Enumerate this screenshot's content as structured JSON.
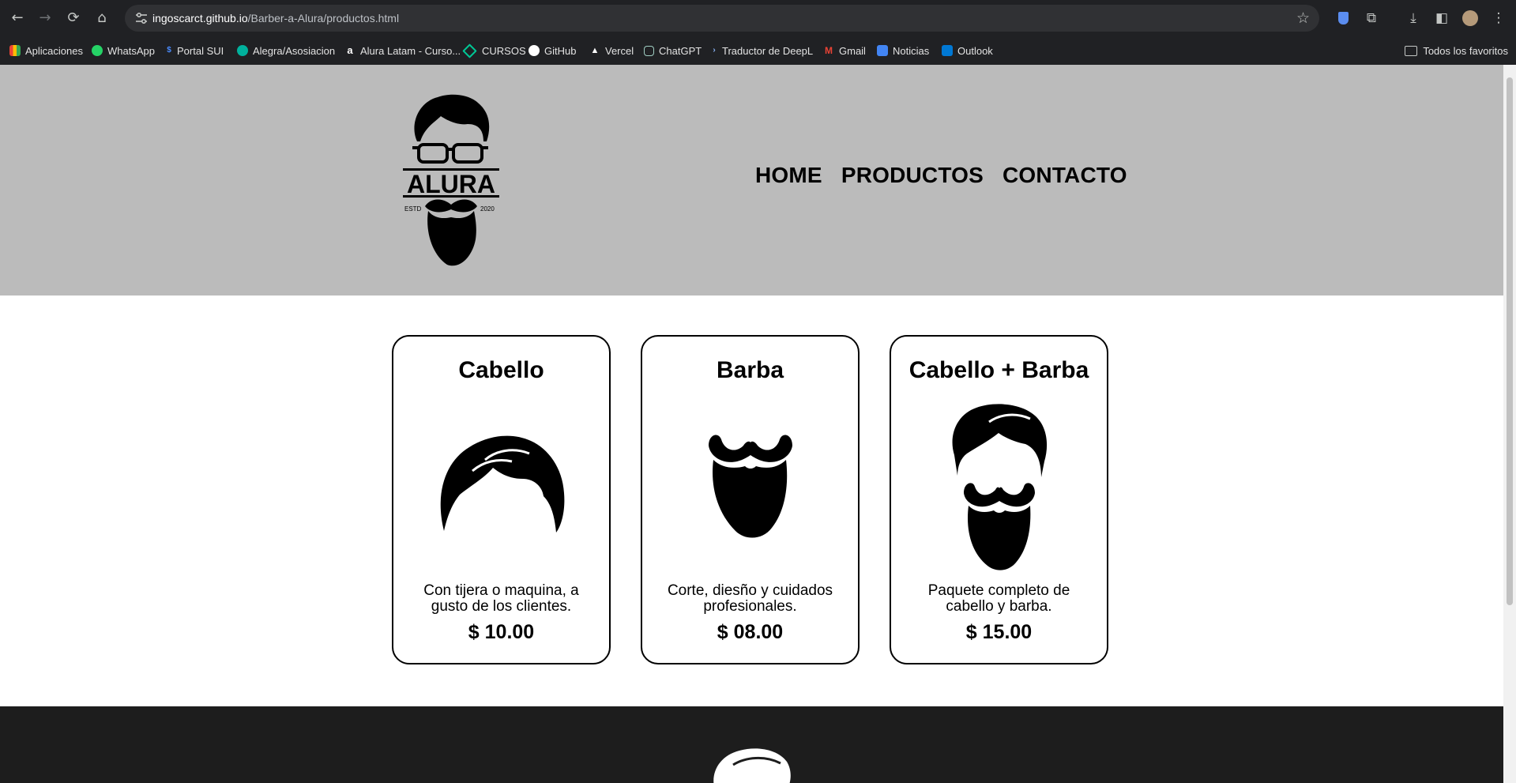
{
  "browser": {
    "url_host": "ingoscarct.github.io",
    "url_path": "/Barber-a-Alura/productos.html",
    "bookmarks": [
      {
        "label": "Aplicaciones",
        "icon": "apps-grid-icon",
        "color": "#ea4335"
      },
      {
        "label": "WhatsApp",
        "icon": "whatsapp-icon",
        "color": "#25d366"
      },
      {
        "label": "Portal SUI",
        "icon": "portal-sui-icon",
        "color": "#1a73e8"
      },
      {
        "label": "Alegra/Asosiacion",
        "icon": "alegra-icon",
        "color": "#00b19d"
      },
      {
        "label": "Alura Latam - Curso...",
        "icon": "alura-icon",
        "color": "#ffffff"
      },
      {
        "label": "CURSOS",
        "icon": "cursos-icon",
        "color": "#00c896"
      },
      {
        "label": "GitHub",
        "icon": "github-icon",
        "color": "#ffffff"
      },
      {
        "label": "Vercel",
        "icon": "vercel-icon",
        "color": "#ffffff"
      },
      {
        "label": "ChatGPT",
        "icon": "chatgpt-icon",
        "color": "#10a37f"
      },
      {
        "label": "Traductor de DeepL",
        "icon": "deepl-icon",
        "color": "#0f2b46"
      },
      {
        "label": "Gmail",
        "icon": "gmail-icon",
        "color": "#ea4335"
      },
      {
        "label": "Noticias",
        "icon": "news-icon",
        "color": "#4285f4"
      },
      {
        "label": "Outlook",
        "icon": "outlook-icon",
        "color": "#0078d4"
      }
    ],
    "all_bookmarks_label": "Todos los favoritos"
  },
  "site": {
    "logo_text": "ALURA",
    "logo_estd": "ESTD",
    "logo_year": "2020",
    "nav": [
      "HOME",
      "PRODUCTOS",
      "CONTACTO"
    ]
  },
  "products": [
    {
      "title": "Cabello",
      "description": "Con tijera o maquina, a gusto de los clientes.",
      "price": "$ 10.00",
      "icon": "hair-icon"
    },
    {
      "title": "Barba",
      "description": "Corte, diesño y cuidados profesionales.",
      "price": "$ 08.00",
      "icon": "beard-icon"
    },
    {
      "title": "Cabello + Barba",
      "description": "Paquete completo de cabello y barba.",
      "price": "$ 15.00",
      "icon": "hair-and-beard-icon"
    }
  ]
}
